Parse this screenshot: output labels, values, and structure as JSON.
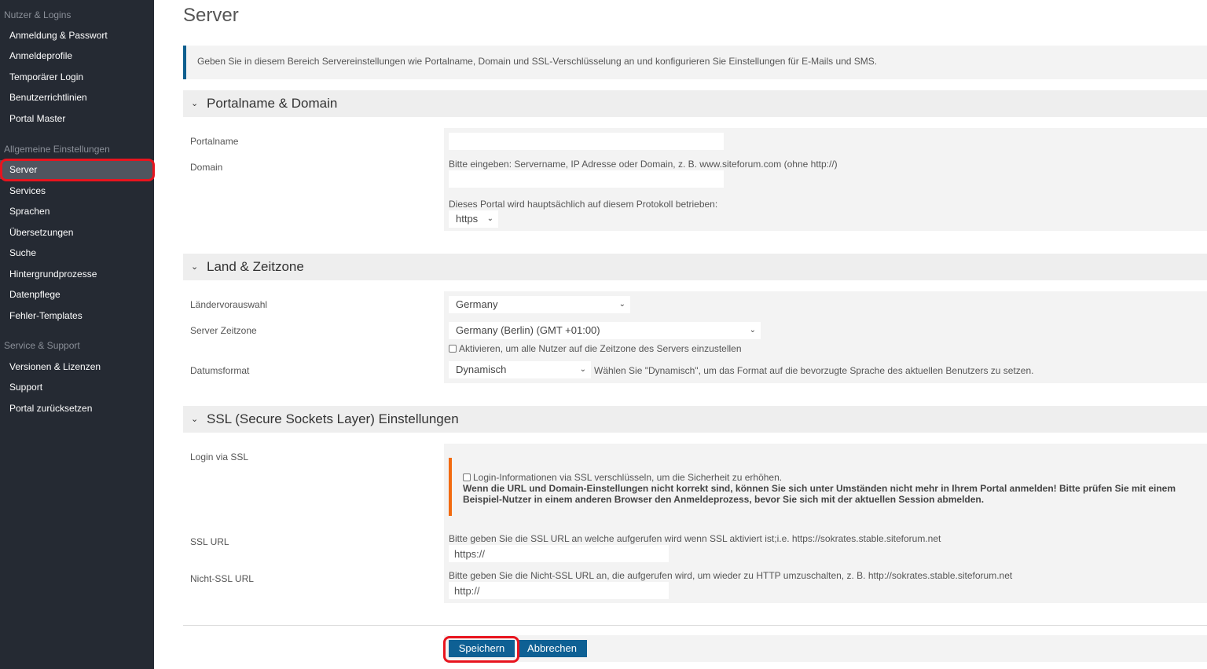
{
  "sidebar": {
    "groups": [
      {
        "title": "Nutzer & Logins",
        "items": [
          "Anmeldung & Passwort",
          "Anmeldeprofile",
          "Temporärer Login",
          "Benutzerrichtlinien",
          "Portal Master"
        ]
      },
      {
        "title": "Allgemeine Einstellungen",
        "items": [
          "Server",
          "Services",
          "Sprachen",
          "Übersetzungen",
          "Suche",
          "Hintergrundprozesse",
          "Datenpflege",
          "Fehler-Templates"
        ]
      },
      {
        "title": "Service & Support",
        "items": [
          "Versionen & Lizenzen",
          "Support",
          "Portal zurücksetzen"
        ]
      }
    ],
    "active": "Server"
  },
  "page": {
    "title": "Server",
    "info": "Geben Sie in diesem Bereich Servereinstellungen wie Portalname, Domain und SSL-Verschlüsselung an und konfigurieren Sie Einstellungen für E-Mails und SMS."
  },
  "portal": {
    "heading": "Portalname & Domain",
    "portalname_label": "Portalname",
    "portalname_value": "",
    "domain_label": "Domain",
    "domain_hint": "Bitte eingeben: Servername, IP Adresse oder Domain, z. B. www.siteforum.com (ohne http://)",
    "domain_value": "",
    "protocol_hint": "Dieses Portal wird hauptsächlich auf diesem Protokoll betrieben:",
    "protocol_value": "https"
  },
  "land": {
    "heading": "Land & Zeitzone",
    "country_label": "Ländervorauswahl",
    "country_value": "Germany",
    "tz_label": "Server Zeitzone",
    "tz_value": "Germany (Berlin) (GMT +01:00)",
    "tz_checkbox": "Aktivieren, um alle Nutzer auf die Zeitzone des Servers einzustellen",
    "date_label": "Datumsformat",
    "date_value": "Dynamisch",
    "date_hint": "Wählen Sie \"Dynamisch\", um das Format auf die bevorzugte Sprache des aktuellen Benutzers zu setzen."
  },
  "ssl": {
    "heading": "SSL (Secure Sockets Layer) Einstellungen",
    "login_label": "Login via SSL",
    "login_checkbox": "Login-Informationen via SSL verschlüsseln, um die Sicherheit zu erhöhen.",
    "warning": "Wenn die URL und Domain-Einstellungen nicht korrekt sind, können Sie sich unter Umständen nicht mehr in Ihrem Portal anmelden! Bitte prüfen Sie mit einem Beispiel-Nutzer in einem anderen Browser den Anmeldeprozess, bevor Sie sich mit der aktuellen Session abmelden.",
    "sslurl_label": "SSL URL",
    "sslurl_hint": "Bitte geben Sie die SSL URL an welche aufgerufen wird wenn SSL aktiviert ist;i.e. https://sokrates.stable.siteforum.net",
    "sslurl_value": "https://",
    "nonssl_label": "Nicht-SSL URL",
    "nonssl_hint": "Bitte geben Sie die Nicht-SSL URL an, die aufgerufen wird, um wieder zu HTTP umzuschalten, z. B. http://sokrates.stable.siteforum.net",
    "nonssl_value": "http://"
  },
  "actions": {
    "save": "Speichern",
    "cancel": "Abbrechen"
  },
  "colors": {
    "sidebar": "#252a33",
    "accent": "#0e6094",
    "warning": "#f26a10",
    "highlight": "#e8141e"
  }
}
